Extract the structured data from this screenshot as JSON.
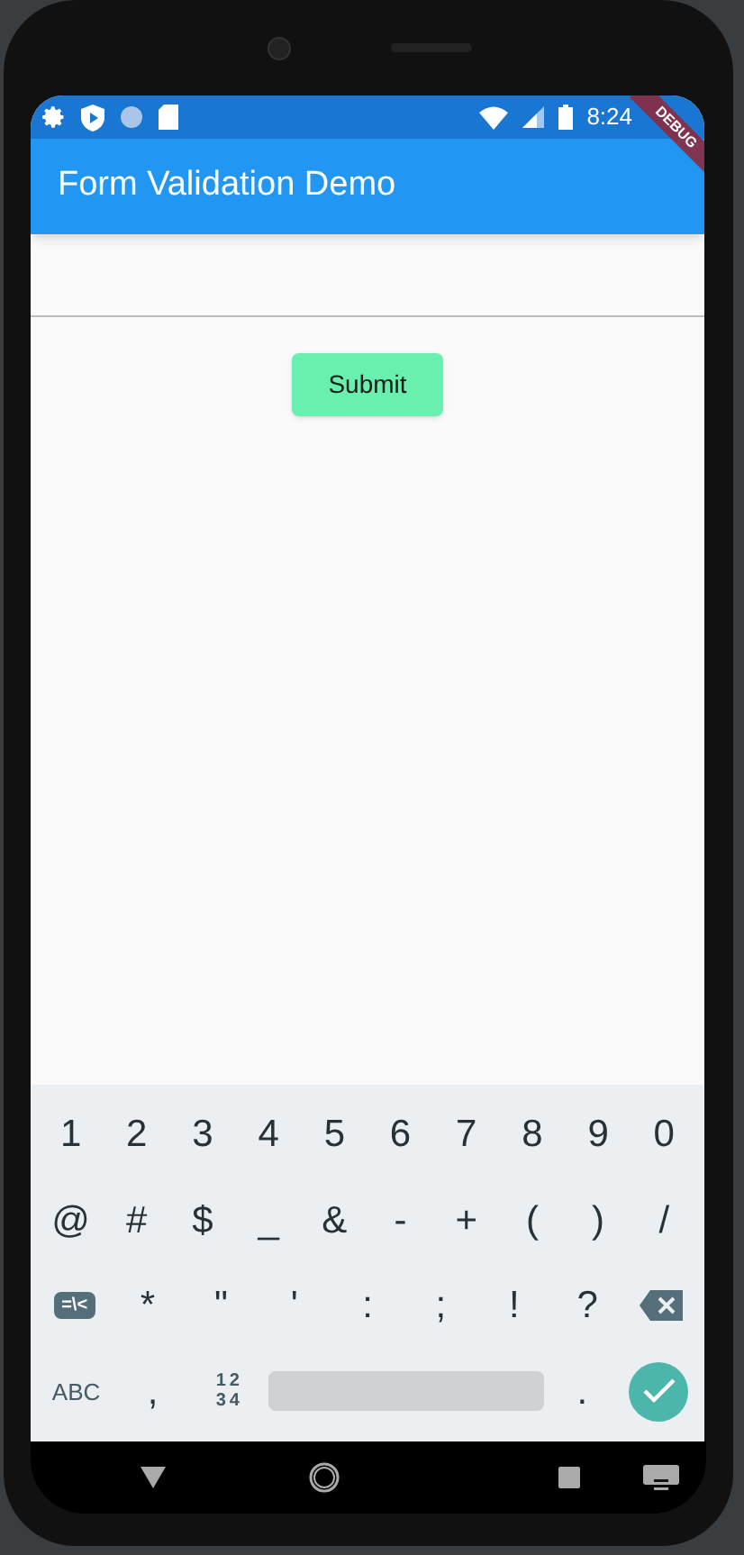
{
  "status_bar": {
    "time": "8:24"
  },
  "debug_banner": "DEBUG",
  "app_bar": {
    "title": "Form Validation Demo"
  },
  "form": {
    "submit": "Submit"
  },
  "keyboard": {
    "rows": [
      [
        {
          "kind": "char",
          "label": "1"
        },
        {
          "kind": "char",
          "label": "2"
        },
        {
          "kind": "char",
          "label": "3"
        },
        {
          "kind": "char",
          "label": "4"
        },
        {
          "kind": "char",
          "label": "5"
        },
        {
          "kind": "char",
          "label": "6"
        },
        {
          "kind": "char",
          "label": "7"
        },
        {
          "kind": "char",
          "label": "8"
        },
        {
          "kind": "char",
          "label": "9"
        },
        {
          "kind": "char",
          "label": "0"
        }
      ],
      [
        {
          "kind": "char",
          "label": "@"
        },
        {
          "kind": "char",
          "label": "#"
        },
        {
          "kind": "char",
          "label": "$"
        },
        {
          "kind": "char",
          "label": "_"
        },
        {
          "kind": "char",
          "label": "&"
        },
        {
          "kind": "char",
          "label": "-"
        },
        {
          "kind": "char",
          "label": "+"
        },
        {
          "kind": "char",
          "label": "("
        },
        {
          "kind": "char",
          "label": ")"
        },
        {
          "kind": "char",
          "label": "/"
        }
      ],
      [
        {
          "kind": "tag",
          "label": "=\\<"
        },
        {
          "kind": "char",
          "label": "*"
        },
        {
          "kind": "char",
          "label": "\""
        },
        {
          "kind": "char",
          "label": "'"
        },
        {
          "kind": "char",
          "label": ":"
        },
        {
          "kind": "char",
          "label": ";"
        },
        {
          "kind": "char",
          "label": "!"
        },
        {
          "kind": "char",
          "label": "?"
        },
        {
          "kind": "backspace"
        }
      ],
      [
        {
          "kind": "small",
          "label": "ABC"
        },
        {
          "kind": "char",
          "label": ","
        },
        {
          "kind": "stacked",
          "lines": [
            "12",
            "34"
          ]
        },
        {
          "kind": "space"
        },
        {
          "kind": "char",
          "label": "."
        },
        {
          "kind": "enter"
        }
      ]
    ]
  }
}
